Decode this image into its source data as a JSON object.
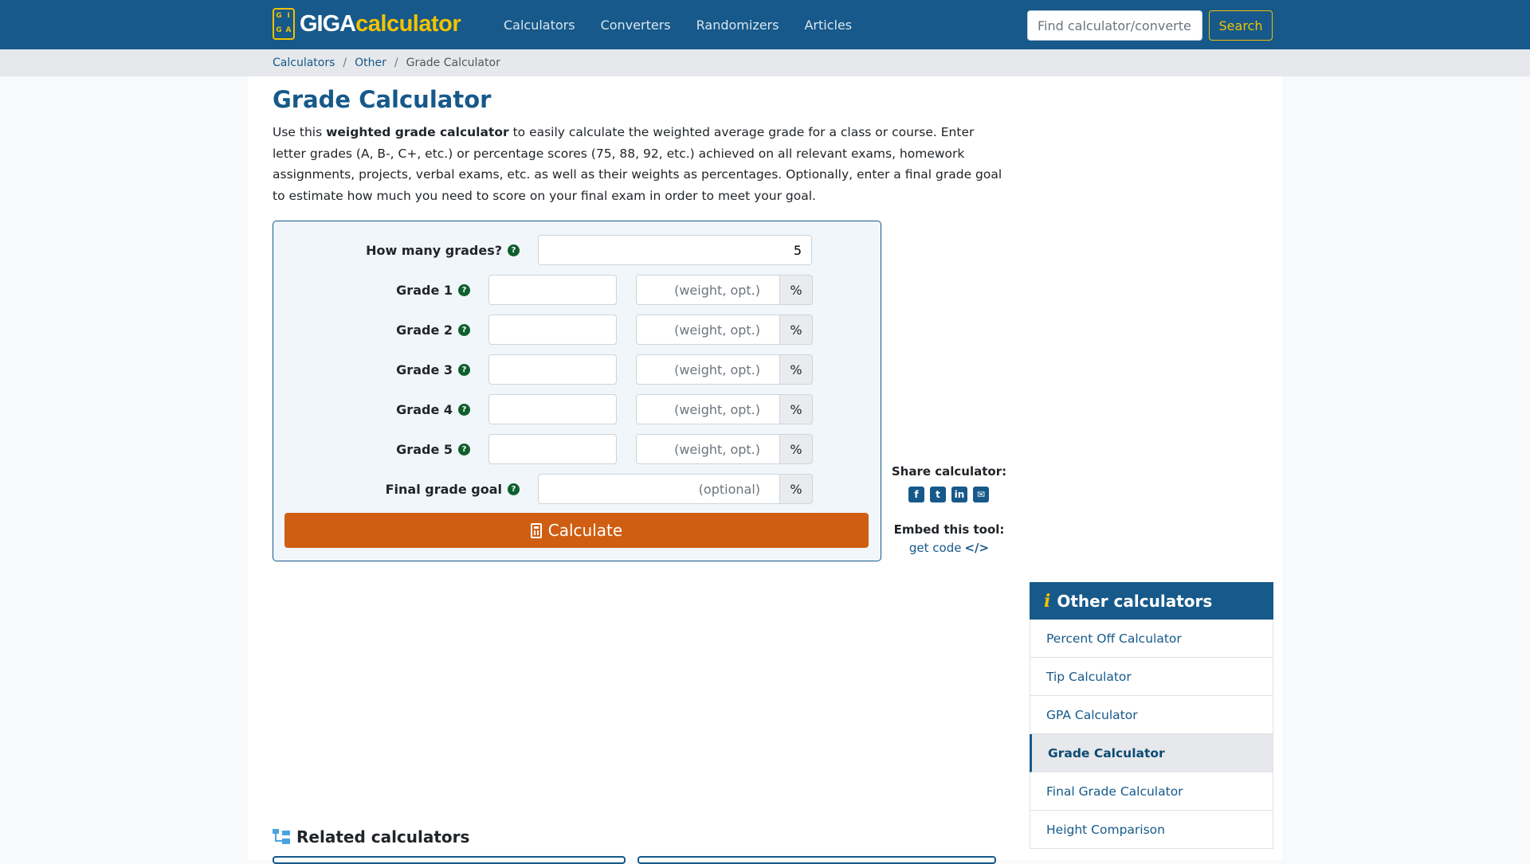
{
  "brand": {
    "giga": "GIGA",
    "calculator": "calculator",
    "box_letters": [
      "G",
      "I",
      "G",
      "A"
    ]
  },
  "nav": {
    "items": [
      {
        "label": "Calculators"
      },
      {
        "label": "Converters"
      },
      {
        "label": "Randomizers"
      },
      {
        "label": "Articles"
      }
    ],
    "search_placeholder": "Find calculator/converter",
    "search_button": "Search"
  },
  "breadcrumb": {
    "items": [
      "Calculators",
      "Other"
    ],
    "separator": "/",
    "current": "Grade Calculator"
  },
  "page": {
    "title": "Grade Calculator",
    "intro_prefix": "Use this ",
    "intro_bold": "weighted grade calculator",
    "intro_rest": " to easily calculate the weighted average grade for a class or course. Enter letter grades (A, B-, C+, etc.) or percentage scores (75, 88, 92, etc.) achieved on all relevant exams, homework assignments, projects, verbal exams, etc. as well as their weights as percentages. Optionally, enter a final grade goal to estimate how much you need to score on your final exam in order to meet your goal."
  },
  "form": {
    "count_label": "How many grades?",
    "count_value": "5",
    "help_glyph": "?",
    "grades": [
      {
        "label": "Grade 1",
        "value": "",
        "weight_placeholder": "(weight, opt.)",
        "unit": "%"
      },
      {
        "label": "Grade 2",
        "value": "",
        "weight_placeholder": "(weight, opt.)",
        "unit": "%"
      },
      {
        "label": "Grade 3",
        "value": "",
        "weight_placeholder": "(weight, opt.)",
        "unit": "%"
      },
      {
        "label": "Grade 4",
        "value": "",
        "weight_placeholder": "(weight, opt.)",
        "unit": "%"
      },
      {
        "label": "Grade 5",
        "value": "",
        "weight_placeholder": "(weight, opt.)",
        "unit": "%"
      }
    ],
    "goal_label": "Final grade goal",
    "goal_placeholder": "(optional)",
    "goal_unit": "%",
    "calculate_label": "Calculate"
  },
  "share": {
    "label": "Share calculator:",
    "icons": [
      "facebook-icon",
      "twitter-icon",
      "linkedin-icon",
      "email-icon"
    ],
    "embed_label": "Embed this tool:",
    "embed_link": "get code",
    "embed_glyph": "</>"
  },
  "sidebar": {
    "title": "Other calculators",
    "items": [
      {
        "label": "Percent Off Calculator",
        "active": false
      },
      {
        "label": "Tip Calculator",
        "active": false
      },
      {
        "label": "GPA Calculator",
        "active": false
      },
      {
        "label": "Grade Calculator",
        "active": true
      },
      {
        "label": "Final Grade Calculator",
        "active": false
      },
      {
        "label": "Height Comparison",
        "active": false
      }
    ]
  },
  "related": {
    "title": "Related calculators"
  },
  "colors": {
    "brand": "#16598a",
    "accent": "#f2c200",
    "button": "#d05e12",
    "help": "#0f5f2c"
  }
}
